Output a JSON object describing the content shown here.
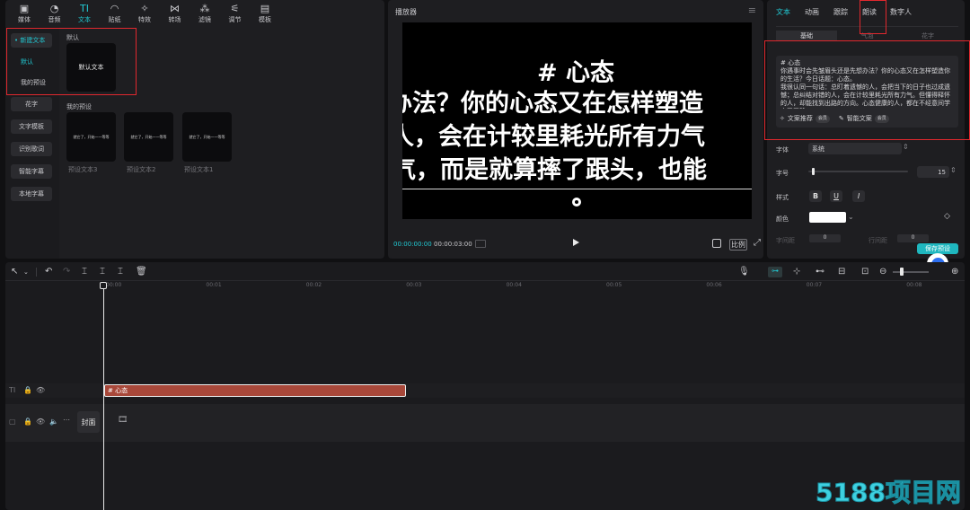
{
  "toolbar": {
    "tabs": [
      {
        "icon": "▣",
        "label": "媒体",
        "name": "media-icon"
      },
      {
        "icon": "◔",
        "label": "音频",
        "name": "audio-icon"
      },
      {
        "icon": "TI",
        "label": "文本",
        "name": "text-icon"
      },
      {
        "icon": "◠",
        "label": "贴纸",
        "name": "sticker-icon"
      },
      {
        "icon": "✧",
        "label": "特效",
        "name": "effects-icon"
      },
      {
        "icon": "⋈",
        "label": "转场",
        "name": "transition-icon"
      },
      {
        "icon": "⁂",
        "label": "滤镜",
        "name": "filter-icon"
      },
      {
        "icon": "⚟",
        "label": "调节",
        "name": "adjust-icon"
      },
      {
        "icon": "▤",
        "label": "模板",
        "name": "template-icon"
      }
    ]
  },
  "left": {
    "new_text": "• 新建文本",
    "default": "默认",
    "my_presets": "我的预设",
    "fancy": "花字",
    "text_template": "文字模板",
    "lyrics": "识别歌词",
    "smart_caption": "智能字幕",
    "local_caption": "本地字幕",
    "section_default": "默认",
    "default_card": "默认文本",
    "section_presets": "我的预设",
    "presets": [
      {
        "thumb": "就它了，开始——等等",
        "caption": "预设文本3"
      },
      {
        "thumb": "就它了，开始——等等",
        "caption": "预设文本2"
      },
      {
        "thumb": "就它了，开始——等等",
        "caption": "预设文本1"
      }
    ]
  },
  "player": {
    "title": "播放器",
    "menu": "≡",
    "title_line": "# 心态",
    "line1": "办法？你的心态又在怎样塑造",
    "line2": "人，会在计较里耗光所有力气",
    "line3": "气，而是就算摔了跟头，也能",
    "time_current": "00:00:00:00",
    "time_total": "00:00:03:00",
    "ratio": "比例"
  },
  "right": {
    "tabs": [
      "文本",
      "动画",
      "跟踪",
      "朗读",
      "数字人"
    ],
    "sub_tabs": [
      "基础",
      "气泡",
      "花字"
    ],
    "content": "# 心态\n你遇事时会先皱眉头还是先想办法？你的心态又在怎样塑造你的生活？今日话题：心态。\n我很认同一句话：总盯着遗憾的人，会把当下的日子也过成遗憾；总纠结对错的人，会在计较里耗光所有力气。但懂得释怀的人，却能找到出路的方向。心态健康的人，都在不经意间学会了平静。",
    "copywriting": "文案推荐",
    "smart_copy": "智能文案",
    "vip": "会员",
    "font_label": "字体",
    "font_value": "系统",
    "size_label": "字号",
    "size_value": "15",
    "style_label": "样式",
    "style_b": "B",
    "style_u": "U",
    "style_i": "I",
    "color_label": "颜色",
    "color_value": "#ffffff",
    "save_preset": "保存预设",
    "row_hidden_1": "字间距",
    "row_hidden_2": "行间距",
    "spacing_value": "0",
    "line_value": "0"
  },
  "timeline": {
    "ticks": [
      "00:00",
      "00:01",
      "00:02",
      "00:03",
      "00:04",
      "00:05",
      "00:06",
      "00:07",
      "00:08"
    ],
    "text_clip": "# 心态",
    "cover": "封面"
  },
  "watermark": "5188项目网",
  "colors": {
    "accent": "#21c8d2",
    "clip": "#a8483a",
    "highlight": "#e0282e"
  }
}
